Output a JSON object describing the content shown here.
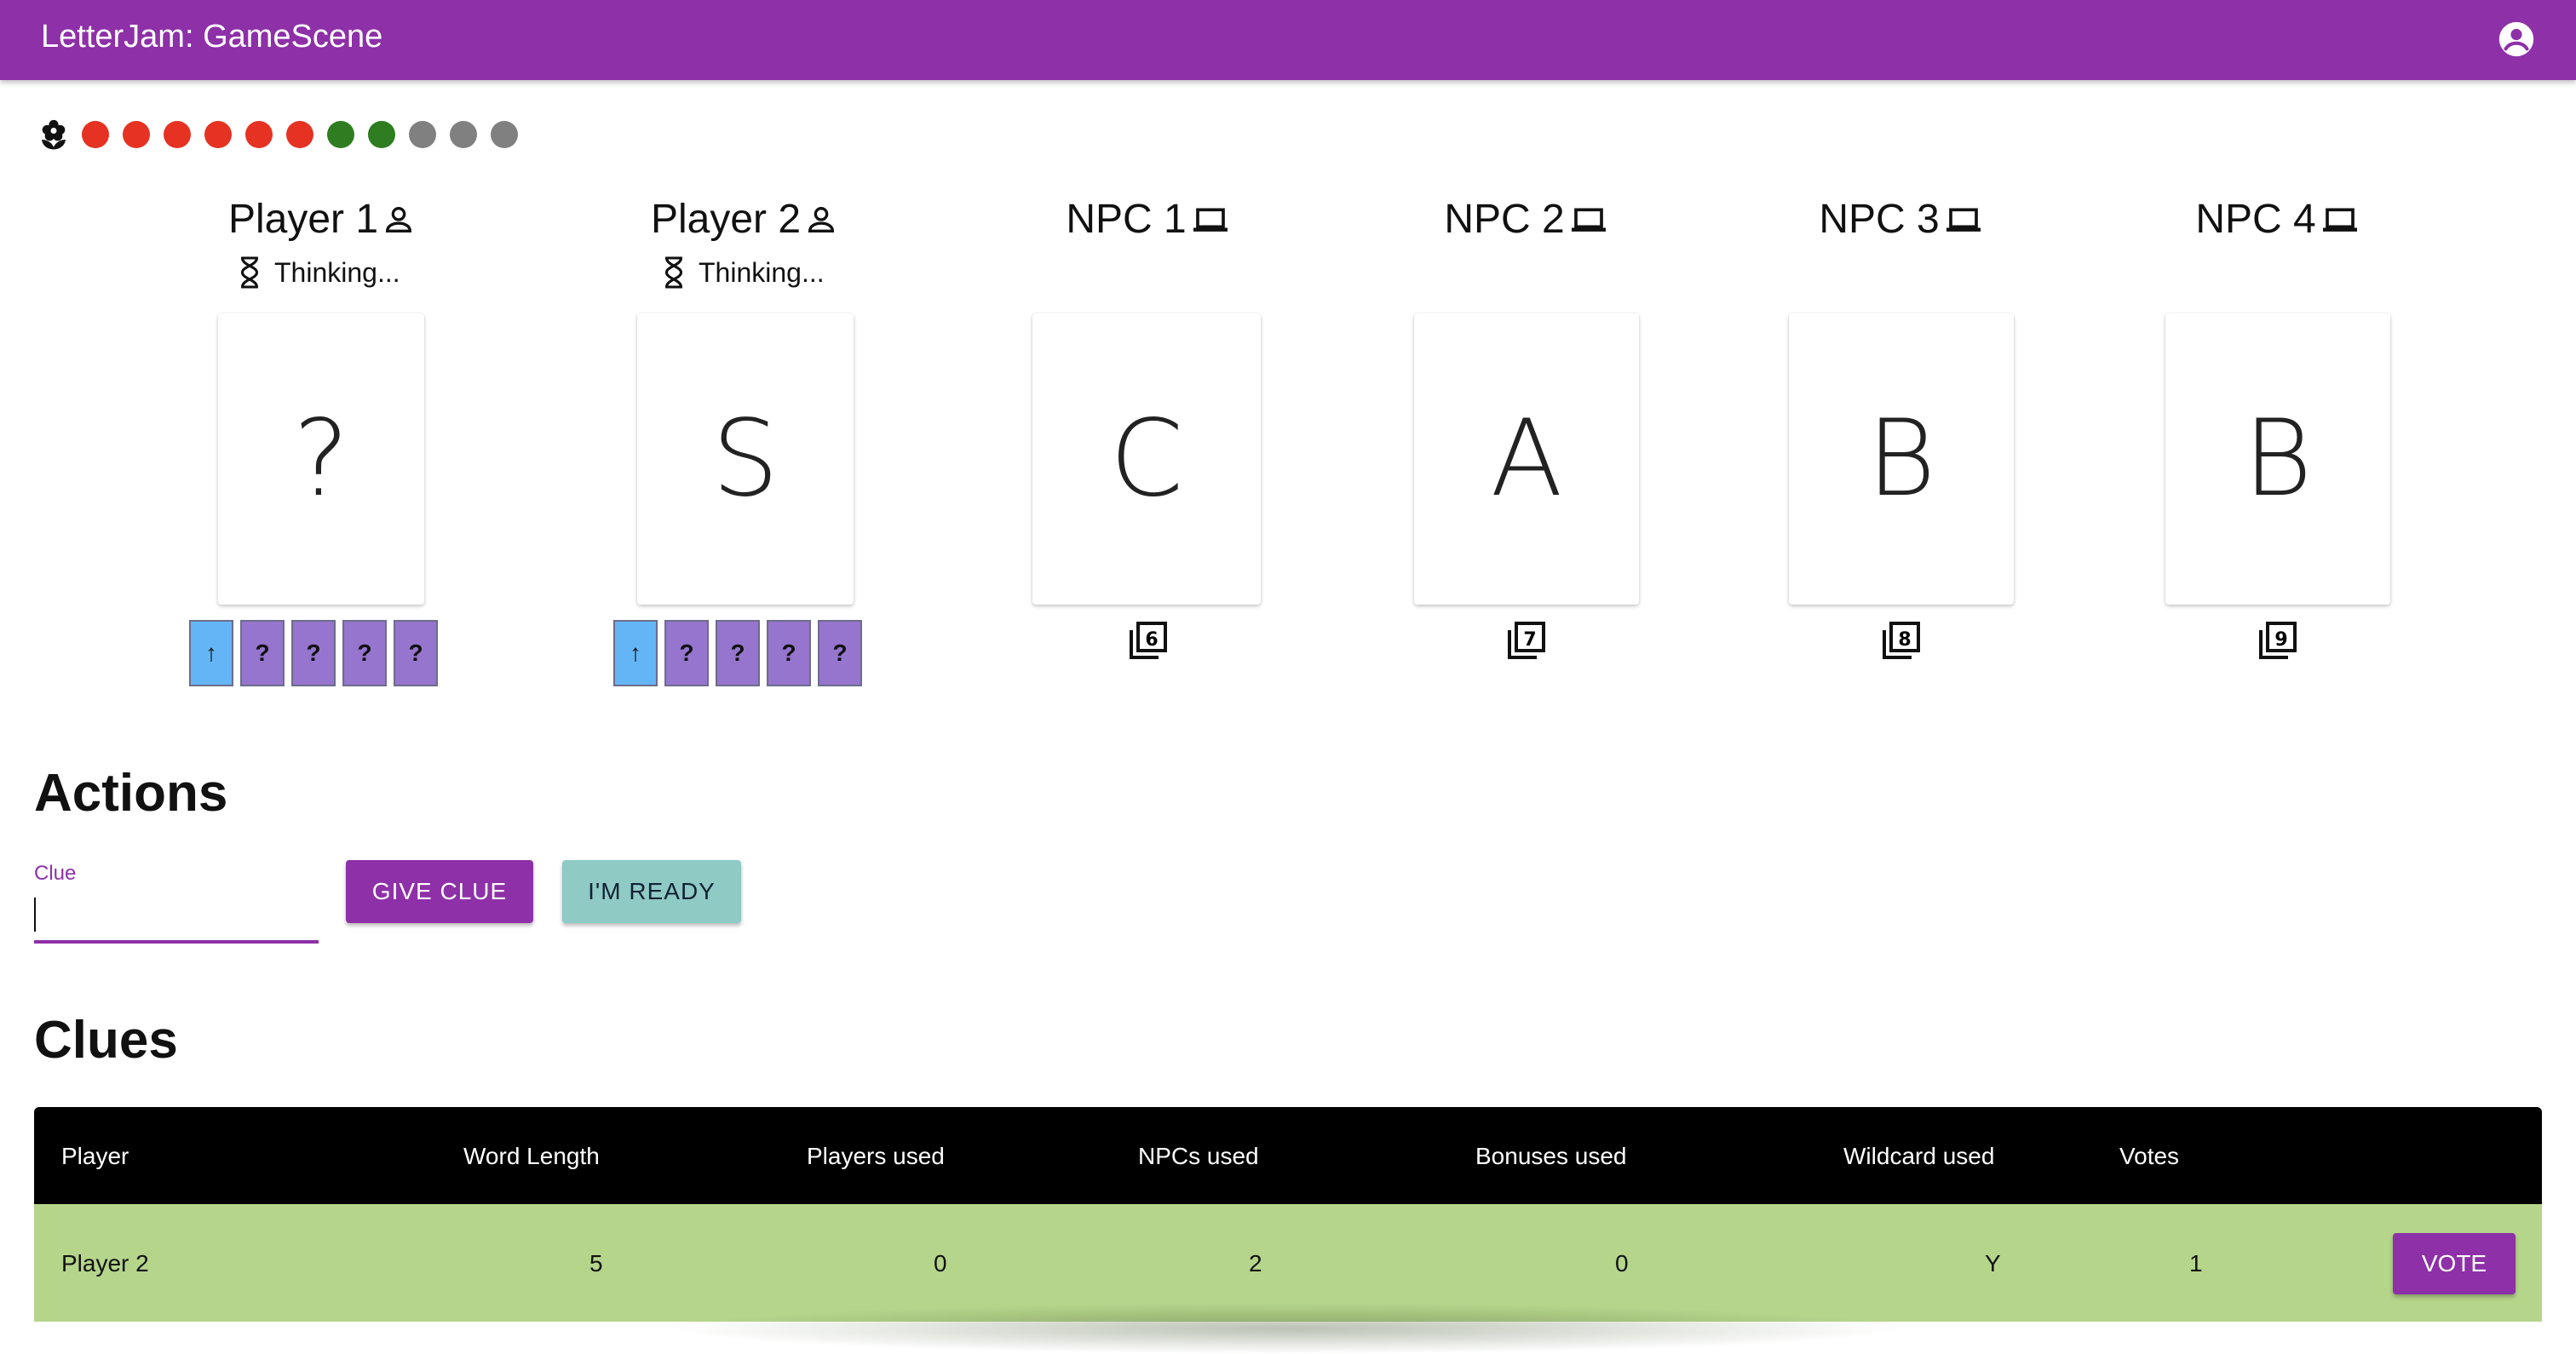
{
  "app": {
    "title": "LetterJam: GameScene"
  },
  "colors": {
    "accent": "#8e30a8",
    "ready": "#8fcac5",
    "row_bg": "#b5d58b",
    "token_red": "#e53222",
    "token_green": "#2e7d20",
    "token_gray": "#808080",
    "chip_unknown": "#9575cd",
    "chip_current": "#64b5f6"
  },
  "tokens": [
    "red",
    "red",
    "red",
    "red",
    "red",
    "red",
    "green",
    "green",
    "gray",
    "gray",
    "gray"
  ],
  "players": [
    {
      "name": "Player 1",
      "kind": "person",
      "status": "Thinking...",
      "card": "?",
      "chips": [
        "↑",
        "?",
        "?",
        "?",
        "?"
      ]
    },
    {
      "name": "Player 2",
      "kind": "person",
      "status": "Thinking...",
      "card": "S",
      "chips": [
        "↑",
        "?",
        "?",
        "?",
        "?"
      ]
    },
    {
      "name": "NPC 1",
      "kind": "computer",
      "card": "C",
      "deck": "6"
    },
    {
      "name": "NPC 2",
      "kind": "computer",
      "card": "A",
      "deck": "7"
    },
    {
      "name": "NPC 3",
      "kind": "computer",
      "card": "B",
      "deck": "8"
    },
    {
      "name": "NPC 4",
      "kind": "computer",
      "card": "B",
      "deck": "9"
    }
  ],
  "actions": {
    "heading": "Actions",
    "clue_label": "Clue",
    "clue_value": "",
    "give_clue": "GIVE CLUE",
    "ready": "I'M READY"
  },
  "clues": {
    "heading": "Clues",
    "columns": [
      "Player",
      "Word Length",
      "Players used",
      "NPCs used",
      "Bonuses used",
      "Wildcard used",
      "Votes"
    ],
    "rows": [
      {
        "player": "Player 2",
        "word_length": "5",
        "players_used": "0",
        "npcs_used": "2",
        "bonuses_used": "0",
        "wildcard_used": "Y",
        "votes": "1",
        "action": "VOTE"
      }
    ]
  }
}
